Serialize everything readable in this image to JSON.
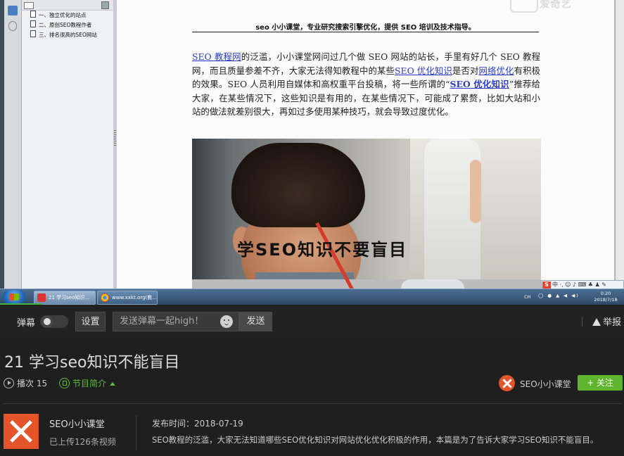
{
  "pdf_viewer": {
    "bookmarks": [
      "一、独立优化的站点",
      "二、原创SEO教程作者",
      "三、排名很高的SEO网站"
    ],
    "doc_header": "seo 小小课堂，专业研究搜索引擎优化，提供 SEO 培训及技术指导。",
    "paragraph": {
      "p1": "SEO 教程网",
      "p2": "的泛滥，小小课堂网问过几个做 SEO 网站的站长，手里有好几个 SEO 教程网，而且质量参差不齐，大家无法得知教程中的某些",
      "p3": "SEO 优化知识",
      "p4": "是否对",
      "p5": "网络优化",
      "p6": "有积极的效果。SEO 人员利用自媒体和高权重平台投稿，将一些所谓的“",
      "p7": "SEO 优化知识",
      "p8": "”推荐给大家，在某些情况下，这些知识是有用的，在某些情况下，可能成了累赘，比如大站和小站的做法就差别很大，再如过多使用某种技巧，就会导致过度优化。"
    },
    "image_overlay_text": "学SEO知识不要盲目"
  },
  "watermark": {
    "text": "爱奇艺"
  },
  "taskbar": {
    "tasks": [
      "21 学习seo知识...",
      "www.xxkt.org(教..."
    ],
    "tray_lang": "CH",
    "tray_icons": "◯ ● ▲ ◀ ◀)",
    "time": "0:20",
    "date": "2018/7/18"
  },
  "sogou_bar": {
    "logo": "S",
    "text": "中 ·, ☺ ♪ ⌨ ♣ ♟ ✎"
  },
  "controls": {
    "danmu_label": "弹幕",
    "settings": "设置",
    "danmu_placeholder": "发送弹幕一起high！",
    "send": "发送",
    "report": "举报"
  },
  "video": {
    "title": "21 学习seo知识不能盲目",
    "plays": "播次 15",
    "intro_label": "节目简介"
  },
  "channel": {
    "name": "SEO小小课堂",
    "follow": "+ 关注",
    "uploads": "已上传126条视频",
    "publish_date": "发布时间：2018-07-19",
    "description": "SEO教程的泛滥，大家无法知道哪些SEO优化知识对网站优化优化积极的作用，本篇是为了告诉大家学习SEO知识不能盲目。"
  },
  "colors": {
    "accent_green": "#5eb42e",
    "channel_orange": "#e3542b",
    "link_blue": "#2a3cc8"
  }
}
